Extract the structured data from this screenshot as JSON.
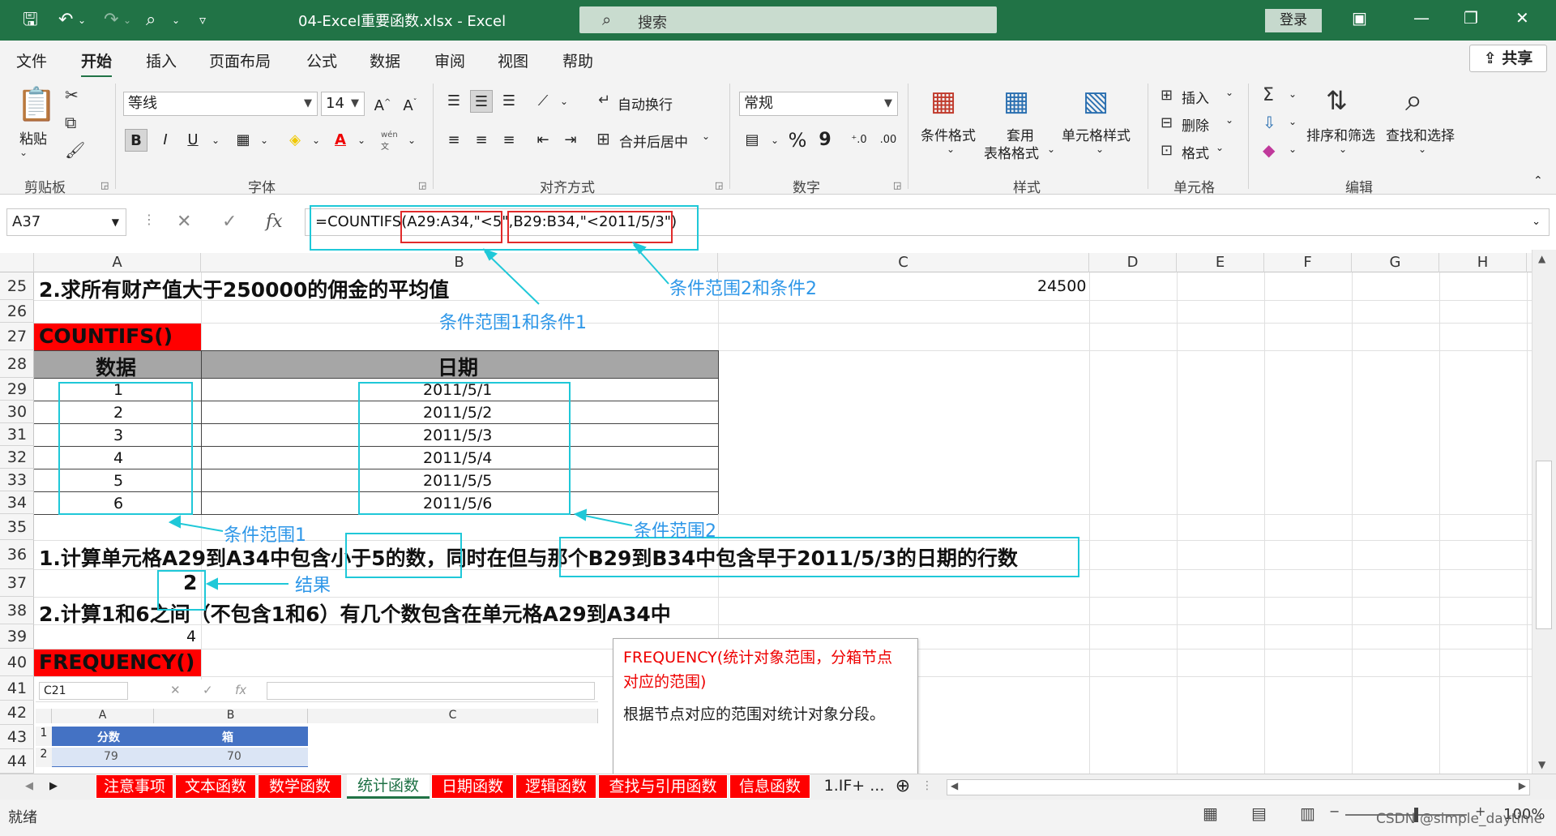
{
  "window": {
    "doc_title": "04-Excel重要函数.xlsx  -  Excel",
    "search_label": "搜索",
    "login_label": "登录"
  },
  "menu": {
    "tabs": [
      "文件",
      "开始",
      "插入",
      "页面布局",
      "公式",
      "数据",
      "审阅",
      "视图",
      "帮助"
    ],
    "share_label": "共享"
  },
  "ribbon": {
    "clipboard": {
      "paste_label": "粘贴",
      "group_label": "剪贴板"
    },
    "font": {
      "font_name": "等线",
      "font_size": "14",
      "bold": "B",
      "italic": "I",
      "underline": "U",
      "group_label": "字体",
      "wen": "wén",
      "wen2": "文"
    },
    "alignment": {
      "wrap_label": "自动换行",
      "merge_label": "合并后居中",
      "group_label": "对齐方式"
    },
    "number": {
      "format": "常规",
      "percent": "%",
      "comma": "9",
      "group_label": "数字"
    },
    "styles": {
      "cond_label": "条件格式",
      "table_label_1": "套用",
      "table_label_2": "表格格式",
      "cell_label": "单元格样式",
      "group_label": "样式"
    },
    "cells": {
      "insert_label": "插入",
      "delete_label": "删除",
      "format_label": "格式",
      "group_label": "单元格"
    },
    "editing": {
      "sort_label": "排序和筛选",
      "find_label": "查找和选择",
      "group_label": "编辑"
    }
  },
  "formula_bar": {
    "name_box": "A37",
    "fx": "fx",
    "formula_prefix": "=COUNTIFS(",
    "formula_part1": "A29:A34,\"<5\"",
    "formula_sep": ",",
    "formula_part2": "B29:B34,\"<2011/5/3\")"
  },
  "columns": [
    "A",
    "B",
    "C",
    "D",
    "E",
    "F",
    "G",
    "H"
  ],
  "rows": [
    "25",
    "26",
    "27",
    "28",
    "29",
    "30",
    "31",
    "32",
    "33",
    "34",
    "35",
    "36",
    "37",
    "38",
    "39",
    "40",
    "41",
    "42",
    "43",
    "44"
  ],
  "sheet": {
    "r25_a": "2.求所有财产值大于250000的佣金的平均值",
    "r25_c": "24500",
    "r27_a": "COUNTIFS()",
    "table_header": [
      "数据",
      "日期"
    ],
    "table_data": [
      "1",
      "2",
      "3",
      "4",
      "5",
      "6"
    ],
    "table_dates": [
      "2011/5/1",
      "2011/5/2",
      "2011/5/3",
      "2011/5/4",
      "2011/5/5",
      "2011/5/6"
    ],
    "r36_a": "1.计算单元格A29到A34中包含小于5的数，同时在但与那个B29到B34中包含早于2011/5/3的日期的行数",
    "r37_a": "2",
    "r38_a": "2.计算1和6之间（不包含1和6）有几个数包含在单元格A29到A34中",
    "r39_a": "4",
    "r40_a": "FREQUENCY()"
  },
  "annotations": {
    "cond1_and_cond": "条件范围1和条件1",
    "cond2_and_cond": "条件范围2和条件2",
    "cond_range1": "条件范围1",
    "cond_range2": "条件范围2",
    "result": "结果"
  },
  "comment": {
    "line1": "FREQUENCY(统计对象范围，分箱节点对应的范围)",
    "line2": "根据节点对应的范围对统计对象分段。"
  },
  "mini": {
    "name_box": "C21",
    "fx": "fx",
    "cols": [
      "A",
      "B",
      "C"
    ],
    "header": [
      "分数",
      "箱"
    ],
    "row2": [
      "79",
      "70"
    ],
    "rownums": [
      "1",
      "2"
    ]
  },
  "sheet_tabs": [
    "注意事项",
    "文本函数",
    "数学函数",
    "统计函数",
    "日期函数",
    "逻辑函数",
    "查找与引用函数",
    "信息函数",
    "1.IF+ ..."
  ],
  "status": {
    "ready": "就绪",
    "zoom": "100%",
    "watermark": "CSDN @simple_daytime"
  },
  "colors": {
    "excel_green": "#217346",
    "annot_blue": "#2e97e8",
    "box_cyan": "#1fc8d8",
    "box_red": "#e12a2a"
  }
}
